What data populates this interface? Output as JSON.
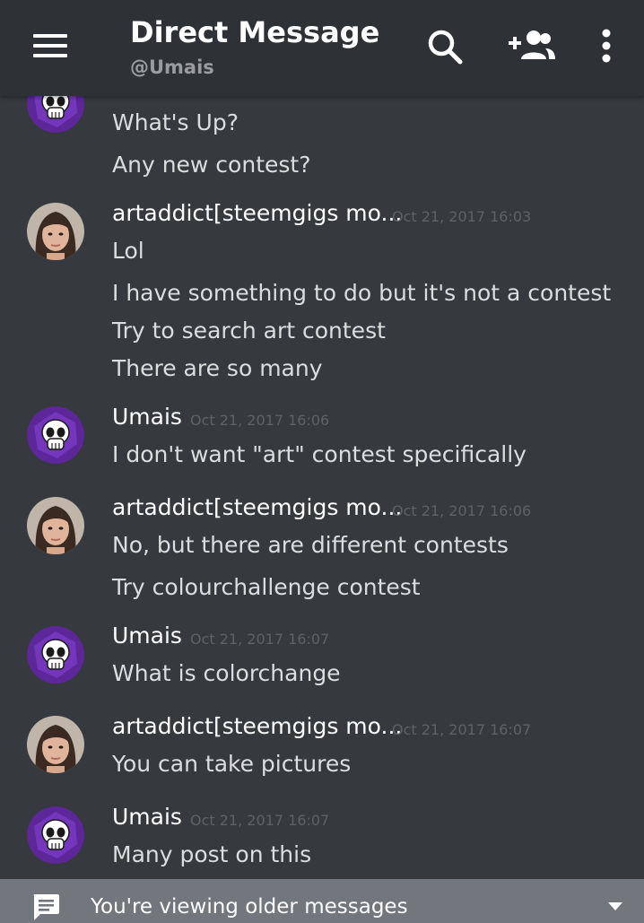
{
  "header": {
    "title": "Direct Message",
    "subtitle": "@Umais",
    "icons": [
      "menu-icon",
      "search-icon",
      "add-friend-icon",
      "more-vertical-icon"
    ]
  },
  "messages": [
    {
      "author": "",
      "timestamp": "",
      "avatar": "umais",
      "lines": [
        "What's Up?",
        "Any new contest?"
      ]
    },
    {
      "author": "artaddict[steemgigs mo...",
      "timestamp": "Oct 21, 2017 16:03",
      "avatar": "artaddict",
      "lines": [
        "Lol",
        "I have something to do but it's not a contest",
        "Try to search art contest",
        "There are so many"
      ]
    },
    {
      "author": "Umais",
      "timestamp": "Oct 21, 2017 16:06",
      "avatar": "umais",
      "lines": [
        "I don't want \"art\" contest specifically"
      ]
    },
    {
      "author": "artaddict[steemgigs mo...",
      "timestamp": "Oct 21, 2017 16:06",
      "avatar": "artaddict",
      "lines": [
        "No, but there are different contests",
        "Try colourchallenge contest"
      ]
    },
    {
      "author": "Umais",
      "timestamp": "Oct 21, 2017 16:07",
      "avatar": "umais",
      "lines": [
        "What is colorchange"
      ]
    },
    {
      "author": "artaddict[steemgigs mo...",
      "timestamp": "Oct 21, 2017 16:07",
      "avatar": "artaddict",
      "lines": [
        "You can take pictures"
      ]
    },
    {
      "author": "Umais",
      "timestamp": "Oct 21, 2017 16:07",
      "avatar": "umais",
      "lines": [
        "Many post on this"
      ]
    }
  ],
  "footer": {
    "text": "You're viewing older messages",
    "icon": "chat-icon",
    "caret_icon": "caret-down-icon"
  },
  "colors": {
    "background": "#36393e",
    "header": "#2e3136",
    "footer_bar": "#72767d",
    "umais_avatar": "#6a2ca8"
  }
}
